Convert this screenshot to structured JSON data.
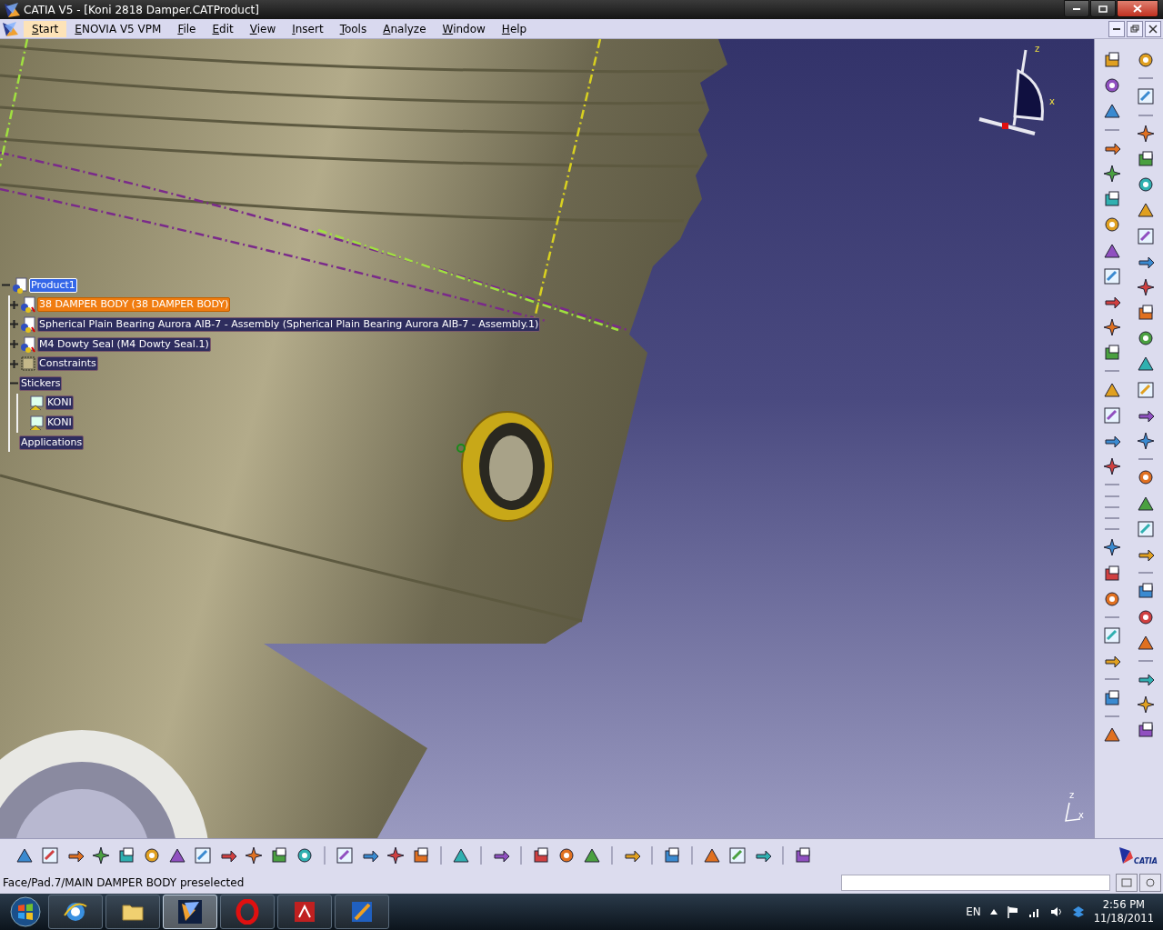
{
  "window": {
    "title": "CATIA V5 - [Koni 2818 Damper.CATProduct]"
  },
  "menu": [
    {
      "label": "Start",
      "selected": true
    },
    {
      "label": "ENOVIA V5 VPM",
      "selected": false
    },
    {
      "label": "File",
      "selected": false
    },
    {
      "label": "Edit",
      "selected": false
    },
    {
      "label": "View",
      "selected": false
    },
    {
      "label": "Insert",
      "selected": false
    },
    {
      "label": "Tools",
      "selected": false
    },
    {
      "label": "Analyze",
      "selected": false
    },
    {
      "label": "Window",
      "selected": false
    },
    {
      "label": "Help",
      "selected": false
    }
  ],
  "tree": {
    "label": "Product1",
    "selected": true,
    "highlighted": false,
    "expanded": true,
    "kind": "product",
    "children": [
      {
        "label": "38 DAMPER BODY (38 DAMPER BODY)",
        "selected": false,
        "highlighted": true,
        "expanded": false,
        "kind": "part"
      },
      {
        "label": "Spherical Plain Bearing Aurora AIB-7 - Assembly (Spherical Plain Bearing Aurora AIB-7 - Assembly.1)",
        "selected": false,
        "highlighted": false,
        "expanded": false,
        "kind": "part"
      },
      {
        "label": "M4 Dowty Seal (M4 Dowty Seal.1)",
        "selected": false,
        "highlighted": false,
        "expanded": false,
        "kind": "part"
      },
      {
        "label": "Constraints",
        "selected": false,
        "highlighted": false,
        "expanded": false,
        "kind": "constraints"
      },
      {
        "label": "Stickers",
        "selected": false,
        "highlighted": false,
        "expanded": true,
        "kind": "folder",
        "children": [
          {
            "label": "KONI",
            "selected": false,
            "highlighted": false,
            "kind": "sticker"
          },
          {
            "label": "KONI",
            "selected": false,
            "highlighted": false,
            "kind": "sticker"
          }
        ]
      },
      {
        "label": "Applications",
        "selected": false,
        "highlighted": false,
        "kind": "folder"
      }
    ]
  },
  "viewport": {
    "compass_labels": [
      "z",
      "x"
    ],
    "mini_axis_labels": [
      "z",
      "x"
    ]
  },
  "brand": {
    "logo_text": "CATIA"
  },
  "status_bar": {
    "text": "Face/Pad.7/MAIN DAMPER BODY preselected"
  },
  "taskbar": {
    "apps": [
      {
        "kind": "browser",
        "selected": false
      },
      {
        "kind": "folder",
        "selected": false
      },
      {
        "kind": "catia",
        "selected": true
      },
      {
        "kind": "opera",
        "selected": false
      },
      {
        "kind": "reader",
        "selected": false
      },
      {
        "kind": "editor",
        "selected": false
      }
    ],
    "language": "EN",
    "time": "2:56 PM",
    "date": "11/18/2011"
  }
}
